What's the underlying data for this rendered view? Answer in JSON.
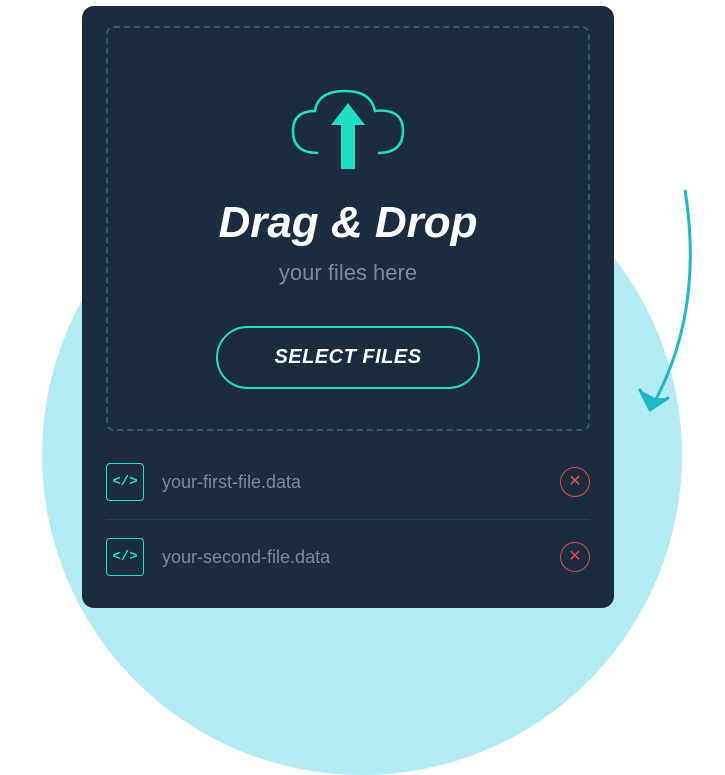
{
  "dropzone": {
    "title": "Drag & Drop",
    "subtitle": "your files here",
    "button_label": "SELECT FILES"
  },
  "files": [
    {
      "name": "your-first-file.data"
    },
    {
      "name": "your-second-file.data"
    }
  ],
  "colors": {
    "card_bg": "#1a2c3d",
    "accent": "#1fe0c4",
    "circle_bg": "#b2ecf2",
    "danger": "#d94a4a",
    "text_muted": "#7a8a99"
  }
}
